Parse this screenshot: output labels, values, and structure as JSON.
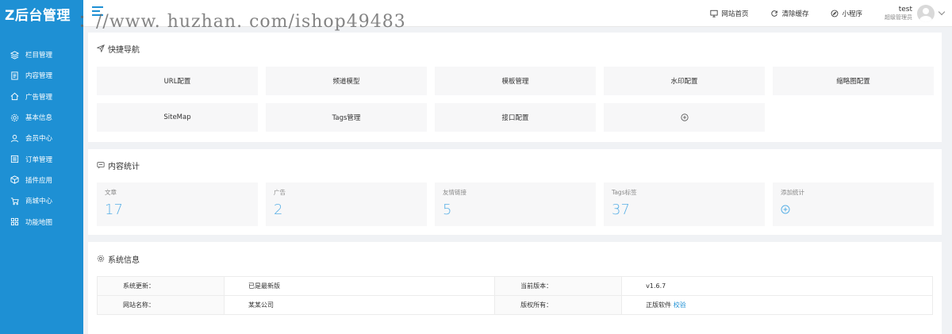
{
  "app": {
    "logo_text": "Z后台管理",
    "watermark": "：//www. huzhan. com/ishop49483"
  },
  "sidebar": {
    "items": [
      {
        "label": "栏目管理",
        "icon": "layers-icon"
      },
      {
        "label": "内容管理",
        "icon": "document-icon"
      },
      {
        "label": "广告管理",
        "icon": "house-icon"
      },
      {
        "label": "基本信息",
        "icon": "gear-icon"
      },
      {
        "label": "会员中心",
        "icon": "user-icon"
      },
      {
        "label": "订单管理",
        "icon": "list-icon"
      },
      {
        "label": "插件应用",
        "icon": "cube-icon"
      },
      {
        "label": "商城中心",
        "icon": "cart-icon"
      },
      {
        "label": "功能地图",
        "icon": "grid-icon"
      }
    ]
  },
  "header": {
    "site_home": "网站首页",
    "clear_cache": "清除缓存",
    "mini_program": "小程序",
    "user_name": "test",
    "user_role": "超级管理员"
  },
  "quick_nav": {
    "title": "快捷导航",
    "buttons": [
      "URL配置",
      "频道模型",
      "模板管理",
      "水印配置",
      "缩略图配置",
      "SiteMap",
      "Tags管理",
      "接口配置"
    ]
  },
  "stats": {
    "title": "内容统计",
    "items": [
      {
        "label": "文章",
        "value": "17"
      },
      {
        "label": "广告",
        "value": "2"
      },
      {
        "label": "友情链接",
        "value": "5"
      },
      {
        "label": "Tags标签",
        "value": "37"
      }
    ],
    "add_label": "添加统计"
  },
  "system": {
    "title": "系统信息",
    "rows": [
      {
        "k1": "系统更新：",
        "v1": "已是最新版",
        "k2": "当前版本：",
        "v2": "v1.6.7"
      },
      {
        "k1": "网站名称：",
        "v1": "某某公司",
        "k2": "版权所有：",
        "v2": "正版软件",
        "v2_link": "校验"
      }
    ]
  },
  "colors": {
    "sidebar": "#1e90d4",
    "stat_value": "#5ab0e6",
    "background": "#f0f2f5"
  }
}
